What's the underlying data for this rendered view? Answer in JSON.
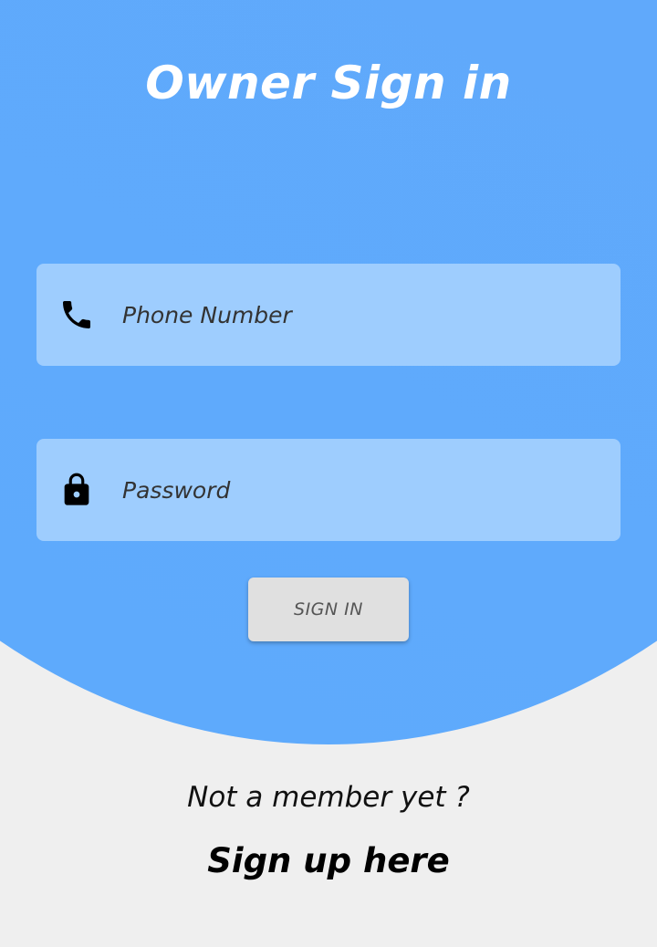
{
  "header": {
    "title": "Owner Sign in"
  },
  "form": {
    "phone": {
      "placeholder": "Phone Number",
      "value": "",
      "icon": "phone-icon"
    },
    "password": {
      "placeholder": "Password",
      "value": "",
      "icon": "lock-icon"
    },
    "signin_label": "SIGN IN"
  },
  "footer": {
    "member_text": "Not a member yet ?",
    "signup_label": "Sign up here"
  },
  "colors": {
    "primary_blue": "#60a9fb",
    "field_blue": "#9ecdfe",
    "button_grey": "#e0e0e0",
    "background": "#efefef"
  }
}
